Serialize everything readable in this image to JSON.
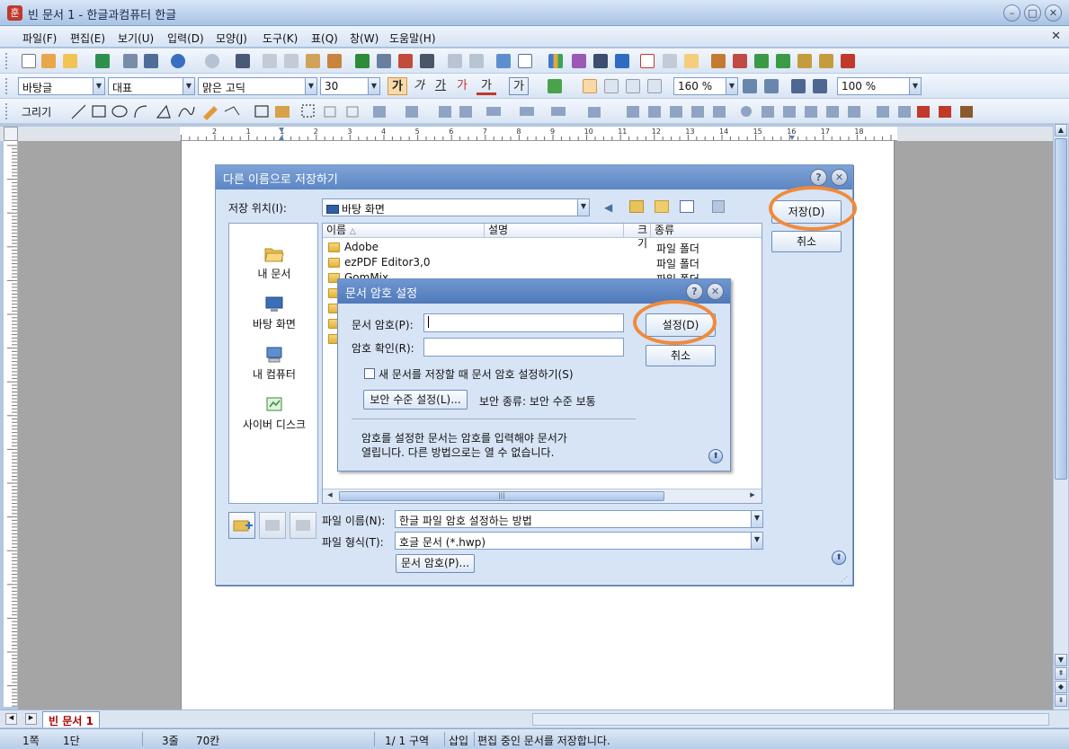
{
  "app": {
    "title": "빈 문서 1 - 한글과컴퓨터 한글",
    "icon_letter": "훈"
  },
  "menu": [
    "파일(F)",
    "편집(E)",
    "보기(U)",
    "입력(D)",
    "모양(J)",
    "도구(K)",
    "표(Q)",
    "창(W)",
    "도움말(H)"
  ],
  "format_bar": {
    "style": "바탕글",
    "language": "대표",
    "font": "맑은 고딕",
    "size": "30",
    "line_spacing": "160 %",
    "zoom": "100 %",
    "bold": "가",
    "italic": "가",
    "underline": "가",
    "strike": "가",
    "color_char": "가",
    "shade_char": "가"
  },
  "draw_bar": {
    "label": "그리기"
  },
  "save_dialog": {
    "title": "다른 이름으로 저장하기",
    "location_label": "저장 위치(I):",
    "location_value": "바탕 화면",
    "places": [
      "내 문서",
      "바탕 화면",
      "내 컴퓨터",
      "사이버 디스크"
    ],
    "columns": [
      "이름",
      "설명",
      "크기",
      "종류"
    ],
    "files": [
      {
        "name": "Adobe",
        "type": "파일 폴더"
      },
      {
        "name": "ezPDF Editor3,0",
        "type": "파일 폴더"
      },
      {
        "name": "GomMix",
        "type": "파일 폴더"
      }
    ],
    "filename_label": "파일 이름(N):",
    "filename_value": "한글 파일 암호 설정하는 방법",
    "filetype_label": "파일 형식(T):",
    "filetype_value": "호글 문서 (*.hwp)",
    "save_button": "저장(D)",
    "cancel_button": "취소",
    "password_button": "문서 암호(P)..."
  },
  "password_dialog": {
    "title": "문서 암호 설정",
    "password_label": "문서 암호(P):",
    "confirm_label": "암호 확인(R):",
    "checkbox_label": "새 문서를 저장할 때 문서 암호 설정하기(S)",
    "security_button": "보안 수준 설정(L)...",
    "security_type": "보안 종류: 보안 수준 보통",
    "info_line1": "암호를 설정한 문서는 암호를 입력해야 문서가",
    "info_line2": "열립니다. 다른 방법으로는 열 수 없습니다.",
    "set_button": "설정(D)",
    "cancel_button": "취소"
  },
  "tabs": {
    "document": "빈 문서 1"
  },
  "status": {
    "page": "1쪽",
    "column": "1단",
    "line": "3줄",
    "col": "70칸",
    "section": "1/ 1 구역",
    "insert": "삽입",
    "message": "편집 중인 문서를 저장합니다."
  },
  "ruler_numbers": [
    "2",
    "1",
    "1",
    "2",
    "3",
    "4",
    "5",
    "6",
    "7",
    "8",
    "9",
    "10",
    "11",
    "12",
    "13",
    "14",
    "15",
    "16",
    "17",
    "18"
  ],
  "highlight_color": "#f08a3b"
}
